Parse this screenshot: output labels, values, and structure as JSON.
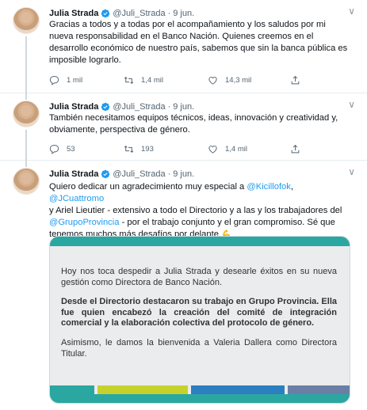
{
  "author": {
    "name": "Julia Strada",
    "handle": "@Juli_Strada",
    "date": "9 jun."
  },
  "colors": {
    "link": "#1d9bf0",
    "verified": "#1d9bf0",
    "card_teal": "#2ba7a1",
    "card_gray": "#ebeced"
  },
  "tweets": [
    {
      "text_lines": [
        "Gracias a todos y a todas por el acompañamiento y los saludos por mi",
        "nueva responsabilidad en el Banco Nación. Quienes creemos en el",
        "desarrollo económico de nuestro país, sabemos que sin la banca pública es",
        "imposible lograrlo."
      ],
      "replies": "1 mil",
      "retweets": "1,4 mil",
      "likes": "14,3 mil"
    },
    {
      "text_lines": [
        "También necesitamos equipos técnicos, ideas, innovación y creatividad y,",
        "obviamente, perspectiva de género."
      ],
      "replies": "53",
      "retweets": "193",
      "likes": "1,4 mil"
    },
    {
      "text": {
        "part1": "Quiero dedicar un agradecimiento muy especial a ",
        "mention1": "@Kicillofok",
        "sep1": ", ",
        "mention2": "@JCuattromo",
        "part2": "y Ariel Lieutier - extensivo a todo el Directorio y a las y los trabajadores del",
        "mention3": "@GrupoProvincia",
        "part3": " - por el trabajo conjunto y el gran compromiso. Sé que",
        "part4": "tenemos muchos más desafíos por delante ",
        "emoji": "💪"
      },
      "card": {
        "p1": "Hoy nos toca despedir a Julia Strada y desearle éxitos en su nueva gestión como Directora de Banco Nación.",
        "p2": "Desde el Directorio destacaron su trabajo en Grupo Provincia. Ella fue quien encabezó la creación del comité de integración comercial y la elaboración colectiva del protocolo de género.",
        "p3": "Asimismo, le damos la bienvenida a Valeria Dallera como Directora Titular."
      }
    }
  ]
}
